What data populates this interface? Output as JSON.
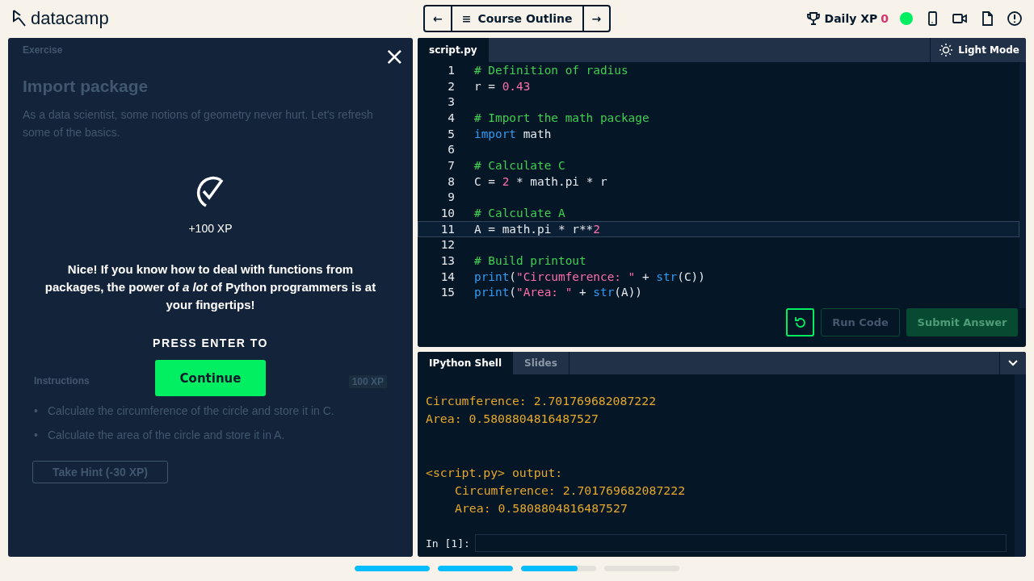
{
  "header": {
    "logo": "datacamp",
    "nav": {
      "back": "←",
      "title": "Course Outline",
      "menu": "≡",
      "forward": "→"
    },
    "daily_xp": {
      "label": "Daily XP",
      "value": "0"
    }
  },
  "exercise": {
    "section": "Exercise",
    "title": "Import package",
    "intro": "As a data scientist, some notions of geometry never hurt. Let's refresh some of the basics.",
    "instructions_label": "Instructions",
    "xp": "100 XP",
    "bullets": [
      {
        "marker": "•",
        "text": "Calculate the circumference of the circle and store it in C."
      },
      {
        "marker": "•",
        "text": "Calculate the area of the circle and store it in A."
      }
    ],
    "hint": "Take Hint (-30 XP)"
  },
  "modal": {
    "close": "×",
    "xp": "+100 XP",
    "message": "Nice! If you know how to deal with functions from packages, the power of *a lot* of Python programmers is at your fingertips!",
    "prompt": "PRESS ENTER TO",
    "button": "Continue"
  },
  "editor": {
    "tab": "script.py",
    "mode": "Light Mode",
    "lines": [
      {
        "n": "1",
        "active": false,
        "tokens": [
          {
            "kind": "comment",
            "text": "# Definition of radius"
          }
        ]
      },
      {
        "n": "2",
        "active": false,
        "tokens": [
          {
            "kind": "plain",
            "text": "r = "
          },
          {
            "kind": "number",
            "text": "0.43"
          }
        ]
      },
      {
        "n": "3",
        "active": false
      },
      {
        "n": "4",
        "active": false,
        "tokens": [
          {
            "kind": "comment",
            "text": "# Import the math package"
          }
        ]
      },
      {
        "n": "5",
        "active": false,
        "tokens": [
          {
            "kind": "keyword",
            "text": "import"
          },
          {
            "kind": "plain",
            "text": " math"
          }
        ]
      },
      {
        "n": "6",
        "active": false
      },
      {
        "n": "7",
        "active": false,
        "tokens": [
          {
            "kind": "comment",
            "text": "# Calculate C"
          }
        ]
      },
      {
        "n": "8",
        "active": false,
        "tokens": [
          {
            "kind": "plain",
            "text": "C = "
          },
          {
            "kind": "number",
            "text": "2"
          },
          {
            "kind": "plain",
            "text": " * math.pi * r"
          }
        ]
      },
      {
        "n": "9",
        "active": false
      },
      {
        "n": "10",
        "active": false,
        "tokens": [
          {
            "kind": "comment",
            "text": "# Calculate A"
          }
        ]
      },
      {
        "n": "11",
        "active": true,
        "tokens": [
          {
            "kind": "plain",
            "text": "A = math.pi * r**"
          },
          {
            "kind": "number",
            "text": "2"
          }
        ]
      },
      {
        "n": "12",
        "active": false
      },
      {
        "n": "13",
        "active": false,
        "tokens": [
          {
            "kind": "comment",
            "text": "# Build printout"
          }
        ]
      },
      {
        "n": "14",
        "active": false,
        "tokens": [
          {
            "kind": "keyword",
            "text": "print"
          },
          {
            "kind": "plain",
            "text": "("
          },
          {
            "kind": "string",
            "text": "\"Circumference: \""
          },
          {
            "kind": "plain",
            "text": " + "
          },
          {
            "kind": "keyword",
            "text": "str"
          },
          {
            "kind": "plain",
            "text": "(C))"
          }
        ]
      },
      {
        "n": "15",
        "active": false,
        "tokens": [
          {
            "kind": "keyword",
            "text": "print"
          },
          {
            "kind": "plain",
            "text": "("
          },
          {
            "kind": "string",
            "text": "\"Area: \""
          },
          {
            "kind": "plain",
            "text": " + "
          },
          {
            "kind": "keyword",
            "text": "str"
          },
          {
            "kind": "plain",
            "text": "(A))"
          }
        ]
      }
    ],
    "buttons": [
      {
        "kind": "reset"
      },
      {
        "kind": "run",
        "label": "Run Code"
      },
      {
        "kind": "submit",
        "label": "Submit Answer"
      }
    ]
  },
  "shell": {
    "tabs": [
      {
        "label": "IPython Shell",
        "selected": true
      },
      {
        "label": "Slides",
        "selected": false
      }
    ],
    "output": [
      {
        "kind": "text",
        "text": "Circumference: 2.701769682087222",
        "indent": false
      },
      {
        "kind": "text",
        "text": "Area: 0.5808804816487527",
        "indent": false
      },
      {
        "kind": "blank"
      },
      {
        "kind": "blank"
      },
      {
        "kind": "text",
        "text": "<script.py> output:",
        "indent": false
      },
      {
        "kind": "text",
        "text": "Circumference: 2.701769682087222",
        "indent": true
      },
      {
        "kind": "text",
        "text": "Area: 0.5808804816487527",
        "indent": true
      }
    ],
    "prompt": "In [1]:"
  },
  "progress": [
    {
      "kind": "started",
      "level": 1
    },
    {
      "kind": "started",
      "level": 1
    },
    {
      "kind": "started",
      "level": 0.75
    },
    {
      "kind": "empty"
    }
  ]
}
